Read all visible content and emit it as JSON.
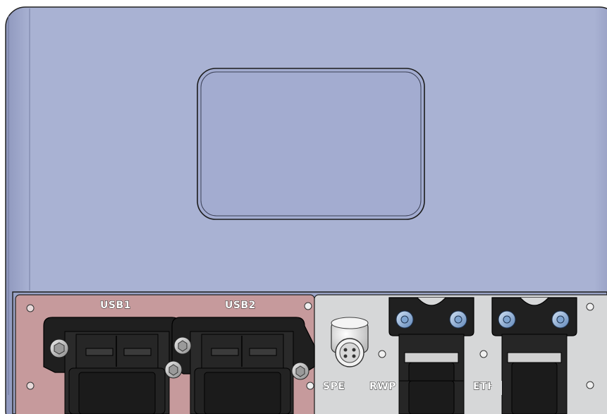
{
  "scene": {
    "view": "front view of device enclosure with connector panel",
    "colors": {
      "housing": "#a7b0d2",
      "housing_edge": "#7e88b0",
      "panel_usb": "#c69a9c",
      "panel_right": "#d6d7d8",
      "connector": "#1d1d1d",
      "screw": "#c4c4c4",
      "screw_blue": "#8fb3d9"
    }
  },
  "labels": {
    "usb1": "USB1",
    "usb2": "USB2",
    "spe": "SPE",
    "rwp": "RWP",
    "eth": "ETH"
  }
}
